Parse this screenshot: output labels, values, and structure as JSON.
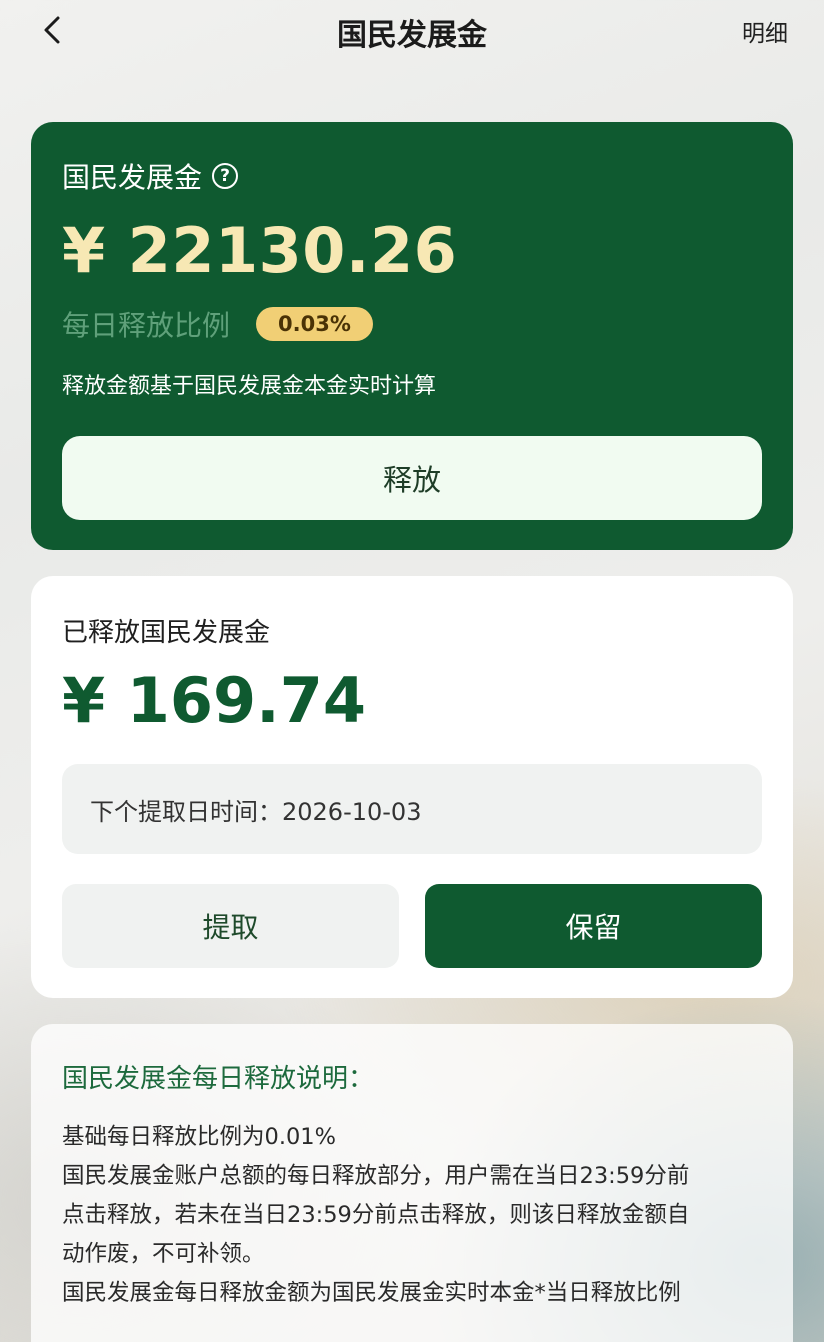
{
  "header": {
    "title": "国民发展金",
    "detail_label": "明细",
    "back_icon": "chevron-left-icon"
  },
  "fund_card": {
    "title": "国民发展金",
    "help_glyph": "?",
    "amount": "¥ 22130.26",
    "ratio_label": "每日释放比例",
    "ratio_value": "0.03%",
    "note": "释放金额基于国民发展金本金实时计算",
    "release_button": "释放"
  },
  "released_card": {
    "title": "已释放国民发展金",
    "amount": "¥ 169.74",
    "next_date_text": "下个提取日时间：2026-10-03",
    "withdraw_button": "提取",
    "keep_button": "保留"
  },
  "description": {
    "title": "国民发展金每日释放说明：",
    "lines": [
      "基础每日释放比例为0.01%",
      "国民发展金账户总额的每日释放部分，用户需在当日23:59分前",
      "点击释放，若未在当日23:59分前点击释放，则该日释放金额自",
      "动作废，不可补领。",
      "国民发展金每日释放金额为国民发展金实时本金*当日释放比例"
    ]
  },
  "colors": {
    "primary_green": "#0f5a30",
    "gold_text": "#f7e8b4",
    "badge_gold": "#f1cf75"
  }
}
